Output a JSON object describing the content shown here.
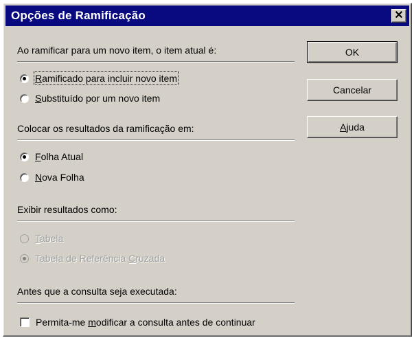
{
  "dialog": {
    "title": "Opções de Ramificação",
    "close_symbol": "✕"
  },
  "sections": {
    "branch": {
      "heading": "Ao ramificar para um novo item, o item atual é:",
      "options": [
        {
          "mnemonic": "R",
          "rest": "amificado para incluir novo item",
          "selected": true
        },
        {
          "mnemonic": "S",
          "rest": "ubstituído por um novo item",
          "selected": false
        }
      ]
    },
    "placement": {
      "heading": "Colocar os resultados da ramificação em:",
      "options": [
        {
          "mnemonic": "F",
          "rest": "olha Atual",
          "selected": true
        },
        {
          "mnemonic": "N",
          "rest": "ova Folha",
          "selected": false
        }
      ]
    },
    "display": {
      "heading": "Exibir resultados como:",
      "options": [
        {
          "pre": "",
          "mnemonic": "T",
          "rest": "abela",
          "selected": false,
          "disabled": true
        },
        {
          "pre": "Tabela de Referência ",
          "mnemonic": "C",
          "rest": "ruzada",
          "selected": true,
          "disabled": true
        }
      ]
    },
    "query": {
      "heading": "Antes que a consulta seja executada:",
      "checkbox": {
        "pre": "Permita-me ",
        "mnemonic": "m",
        "rest": "odificar a consulta antes de continuar",
        "checked": false
      }
    }
  },
  "buttons": {
    "ok": "OK",
    "cancel": "Cancelar",
    "help_mnemonic": "A",
    "help_rest": "juda"
  }
}
